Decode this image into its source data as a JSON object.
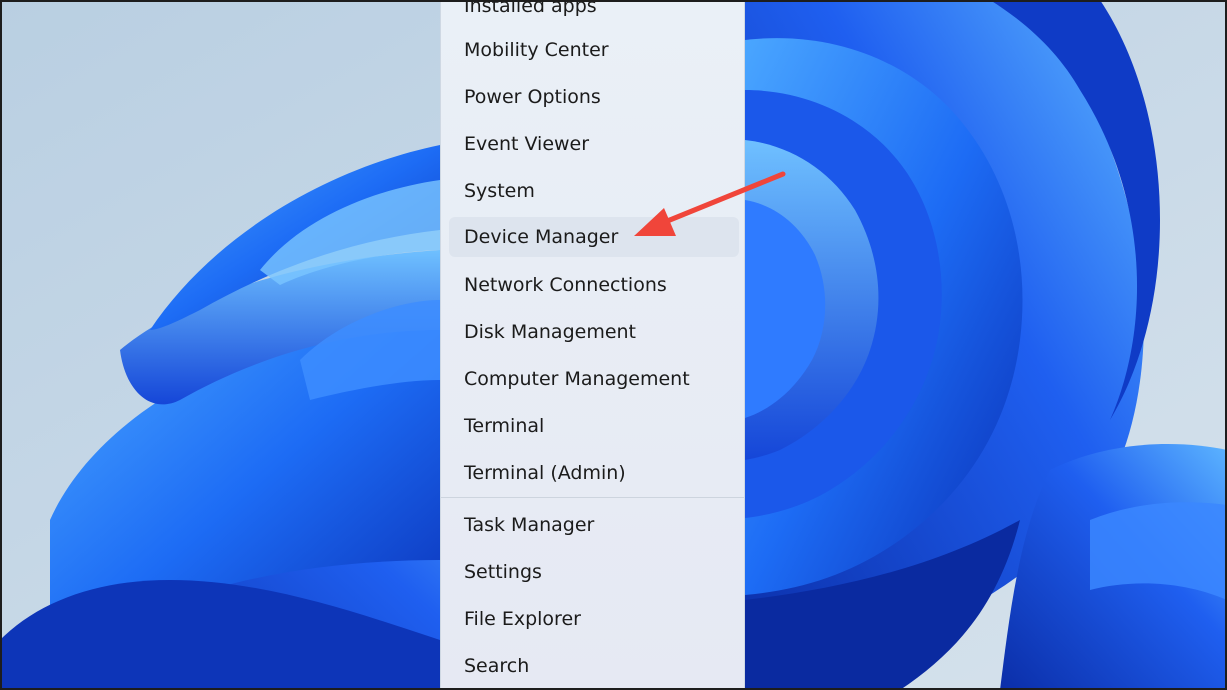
{
  "context_menu": {
    "items": [
      {
        "label": "Installed apps"
      },
      {
        "label": "Mobility Center"
      },
      {
        "label": "Power Options"
      },
      {
        "label": "Event Viewer"
      },
      {
        "label": "System"
      },
      {
        "label": "Device Manager"
      },
      {
        "label": "Network Connections"
      },
      {
        "label": "Disk Management"
      },
      {
        "label": "Computer Management"
      },
      {
        "label": "Terminal"
      },
      {
        "label": "Terminal (Admin)"
      },
      {
        "label": "Task Manager"
      },
      {
        "label": "Settings"
      },
      {
        "label": "File Explorer"
      },
      {
        "label": "Search"
      }
    ],
    "highlighted_item": "Device Manager"
  },
  "annotation": {
    "arrow_color": "#f0453a"
  },
  "wallpaper": {
    "name": "windows-11-bloom",
    "background_color": "#c9d9e6",
    "accent_color": "#1f5ff0"
  }
}
